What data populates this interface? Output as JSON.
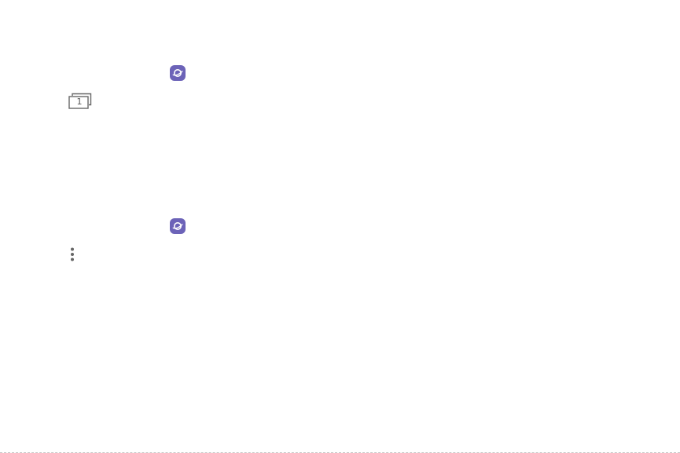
{
  "icons": {
    "internet_app_1": "samsung-internet-icon",
    "tabs": "tabs-icon",
    "internet_app_2": "samsung-internet-icon",
    "more": "more-options-icon"
  },
  "tabs": {
    "count": "1"
  },
  "colors": {
    "app_icon_bg": "#6c63b8",
    "glyph_gray": "#666666"
  }
}
